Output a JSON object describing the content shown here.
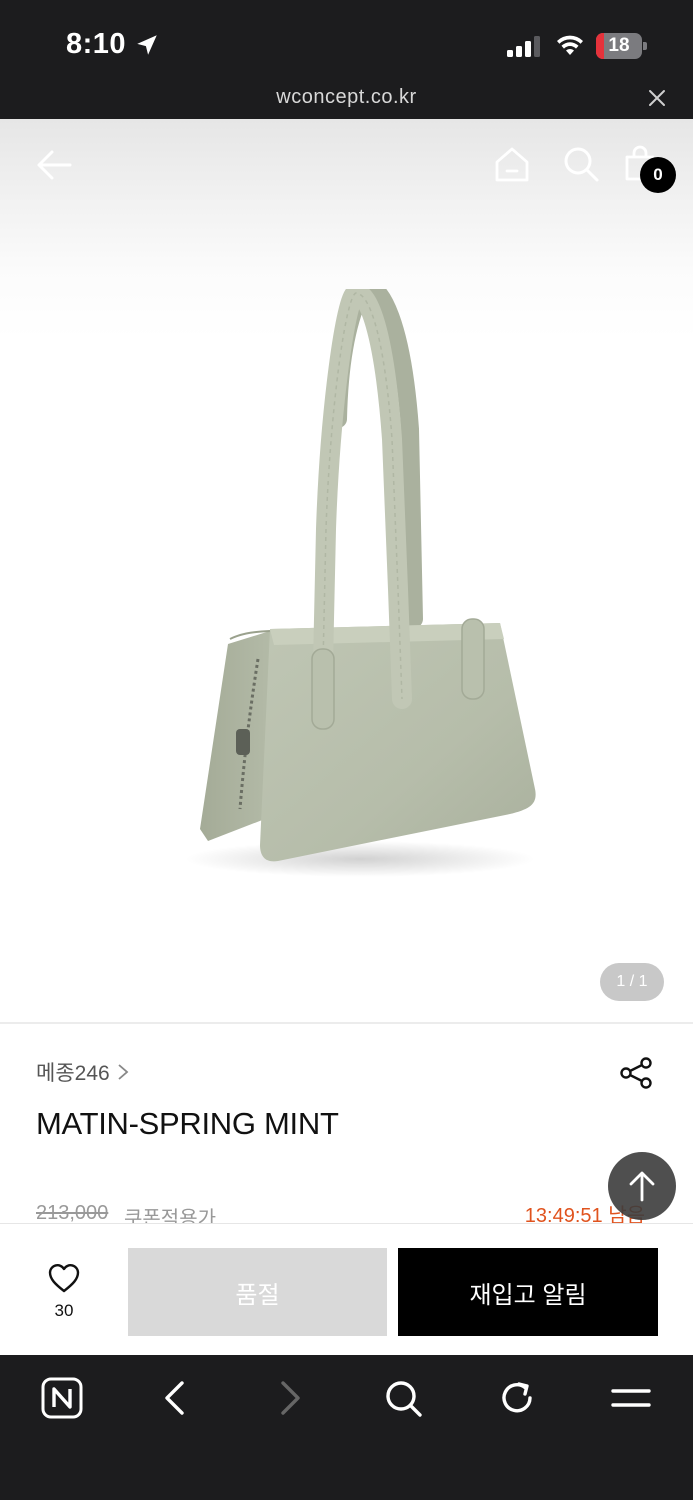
{
  "status_bar": {
    "time": "8:10",
    "battery_level": "18",
    "battery_fraction": 0.18,
    "battery_color": "#e5323b"
  },
  "url_bar": {
    "url": "wconcept.co.kr",
    "close_icon": "close-icon"
  },
  "top_nav": {
    "back_icon": "arrow-left-icon",
    "home_icon": "home-icon",
    "search_icon": "search-icon",
    "cart_icon": "shopping-bag-icon",
    "cart_count": "0"
  },
  "gallery": {
    "image_alt": "mint shoulder bag product photo",
    "counter": "1 / 1"
  },
  "product": {
    "brand": "메종246",
    "name": "MATIN-SPRING MINT",
    "original_price": "213,000",
    "price_note": "쿠폰적용가",
    "timer": "13:49:51 남음",
    "timer_color": "#e0531e"
  },
  "actions": {
    "wish_count": "30",
    "soldout_label": "품절",
    "restock_label": "재입고 알림"
  },
  "browser_toolbar": {
    "icons": [
      "naver-n-icon",
      "back-chevron-icon",
      "forward-chevron-icon",
      "search-icon",
      "refresh-icon",
      "menu-icon"
    ]
  }
}
